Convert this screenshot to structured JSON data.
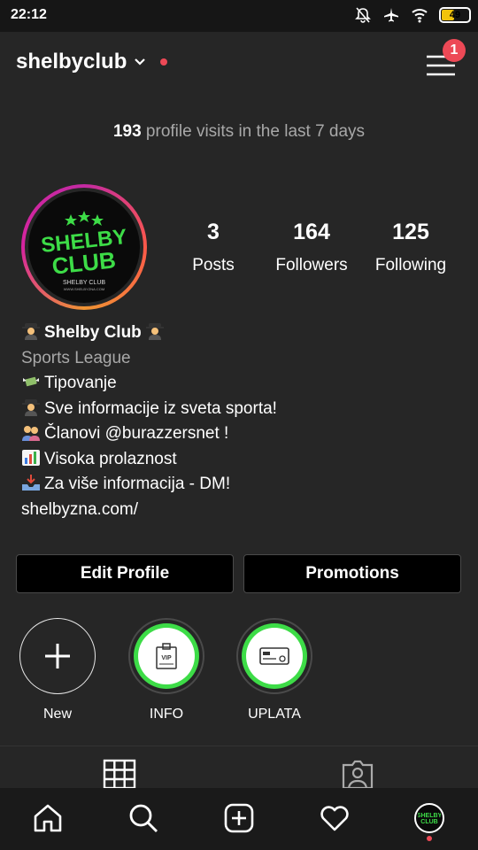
{
  "status_bar": {
    "time": "22:12",
    "battery": "49"
  },
  "header": {
    "username": "shelbyclub",
    "notification_count": "1"
  },
  "insights": {
    "visits_count": "193",
    "visits_text": " profile visits in the last 7 days"
  },
  "profile": {
    "avatar_text": "SHELBY CLUB",
    "avatar_subtext": "SHELBY CLUB"
  },
  "stats": [
    {
      "value": "3",
      "label": "Posts"
    },
    {
      "value": "164",
      "label": "Followers"
    },
    {
      "value": "125",
      "label": "Following"
    }
  ],
  "bio": {
    "name": "Shelby Club",
    "category": "Sports League",
    "lines": [
      {
        "icon": "money-wings-icon",
        "text": "Tipovanje"
      },
      {
        "icon": "detective-icon",
        "text": "Sve informacije iz sveta sporta!"
      },
      {
        "icon": "people-icon",
        "text": "Članovi @burazzersnet !"
      },
      {
        "icon": "bar-chart-icon",
        "text": "Visoka prolaznost"
      },
      {
        "icon": "inbox-tray-icon",
        "text": "Za više informacija - DM!"
      }
    ],
    "website": "shelbyzna.com/"
  },
  "actions": {
    "edit_profile": "Edit Profile",
    "promotions": "Promotions"
  },
  "highlights": [
    {
      "label": "New",
      "icon": "plus-icon"
    },
    {
      "label": "INFO",
      "icon": "vip-ticket-icon"
    },
    {
      "label": "UPLATA",
      "icon": "card-icon"
    }
  ],
  "colors": {
    "background": "#262626",
    "accent_red": "#ed4956",
    "highlight_green": "#3ddc47"
  }
}
